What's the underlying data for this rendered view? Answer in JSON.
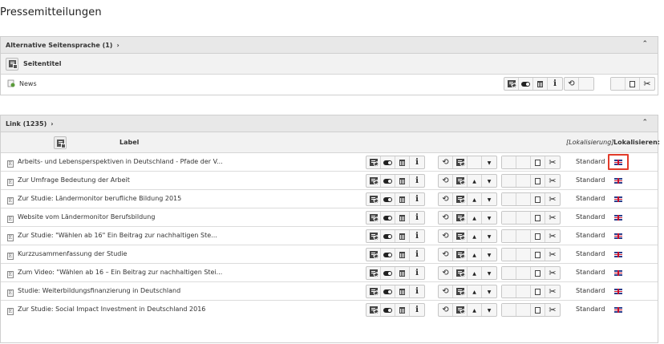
{
  "page": {
    "title": "Pressemitteilungen"
  },
  "panel1": {
    "header": "Alternative Seitensprache (1)",
    "column_title": "Seitentitel",
    "rows": [
      {
        "title": "News"
      }
    ]
  },
  "panel2": {
    "header": "Link (1235)",
    "column_label": "Label",
    "column_localization": "[Lokalisierung]",
    "column_localize": "Lokalisieren:",
    "rows": [
      {
        "title": "Arbeits- und Lebensperspektiven in Deutschland - Pfade der V...",
        "status": "Standard"
      },
      {
        "title": "Zur Umfrage Bedeutung der Arbeit",
        "status": "Standard"
      },
      {
        "title": "Zur Studie: Ländermonitor berufliche Bildung 2015",
        "status": "Standard"
      },
      {
        "title": "Website vom Ländermonitor Berufsbildung",
        "status": "Standard"
      },
      {
        "title": "Zur Studie: \"Wählen ab 16\" Ein Beitrag zur nachhaltigen Ste...",
        "status": "Standard"
      },
      {
        "title": "Kurzzusammenfassung der Studie",
        "status": "Standard"
      },
      {
        "title": "Zum Video: \"Wählen ab 16 – Ein Beitrag zur nachhaltigen Stei...",
        "status": "Standard"
      },
      {
        "title": "Studie: Weiterbildungsfinanzierung in Deutschland",
        "status": "Standard"
      },
      {
        "title": "Zur Studie: Social Impact Investment in Deutschland 2016",
        "status": "Standard"
      }
    ]
  },
  "glyphs": {
    "info": "i",
    "arrow": "›",
    "caret": "⌃",
    "history": "⟲",
    "cut": "✂"
  },
  "colors": {
    "highlight": "#e23b2a",
    "header_bg": "#e8e8e8",
    "flag_blue": "#2c3f8c",
    "flag_red": "#c8102e"
  }
}
